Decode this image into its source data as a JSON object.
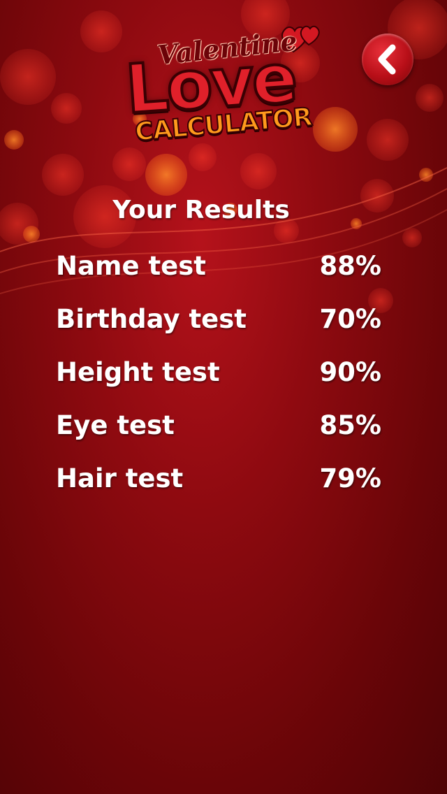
{
  "logo": {
    "line1": "Valentine",
    "line2": "Love",
    "line3": "CALCULATOR"
  },
  "back_button": {
    "icon": "chevron-left-icon"
  },
  "results": {
    "title": "Your Results",
    "items": [
      {
        "label": "Name test",
        "value": "88%"
      },
      {
        "label": "Birthday test",
        "value": "70%"
      },
      {
        "label": "Height test",
        "value": "90%"
      },
      {
        "label": "Eye test",
        "value": "85%"
      },
      {
        "label": "Hair test",
        "value": "79%"
      }
    ]
  },
  "colors": {
    "background": "#8e0a10",
    "text": "#ffffff",
    "logo_red": "#e0202a",
    "logo_orange": "#ff9a1c"
  }
}
